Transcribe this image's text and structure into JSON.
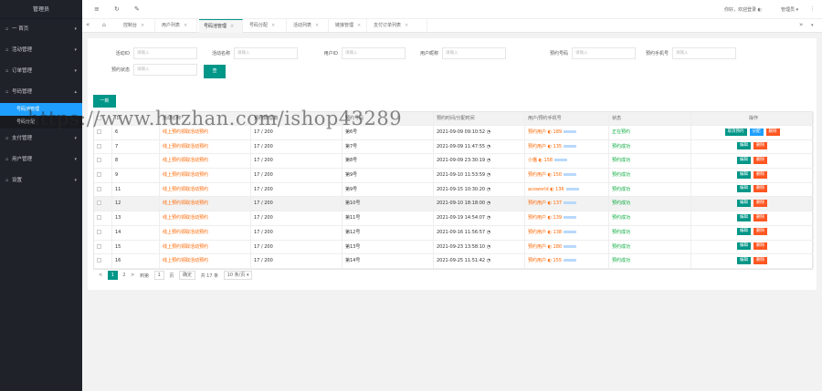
{
  "sidebar": {
    "logo": "管理员",
    "items": [
      {
        "label": "一 首页",
        "icon": "home-icon",
        "chevron": "▾"
      },
      {
        "label": "活动管理",
        "icon": "grid-icon",
        "chevron": "▾"
      },
      {
        "label": "订单管理",
        "icon": "list-icon",
        "chevron": "▾"
      },
      {
        "label": "号码管理",
        "icon": "tag-icon",
        "chevron": "▴"
      }
    ],
    "sub_items": [
      "号码池管理",
      "号码分配"
    ],
    "items_after": [
      {
        "label": "支付管理",
        "icon": "wallet-icon",
        "chevron": "▾"
      },
      {
        "label": "用户管理",
        "icon": "user-icon",
        "chevron": "▾"
      },
      {
        "label": "设置",
        "icon": "gear-icon",
        "chevron": "▾"
      }
    ]
  },
  "header": {
    "user_text": "你好，欢迎登录 ◐",
    "admin": "管理员 ▾",
    "more": "⋮"
  },
  "tabs": [
    {
      "label": "控制台"
    },
    {
      "label": "用户列表"
    },
    {
      "label": "号码池管理"
    },
    {
      "label": "号码分配"
    },
    {
      "label": "活动列表"
    },
    {
      "label": "链接管理"
    },
    {
      "label": "支付订单列表"
    }
  ],
  "filters": [
    {
      "label": "活动ID",
      "placeholder": "请输入"
    },
    {
      "label": "活动名称",
      "placeholder": "请输入"
    },
    {
      "label": "用户ID",
      "placeholder": "请输入"
    },
    {
      "label": "用户昵称",
      "placeholder": "请输入"
    },
    {
      "label": "预约号码",
      "placeholder": "请输入"
    },
    {
      "label": "预约手机号",
      "placeholder": "请输入"
    },
    {
      "label": "预约状态",
      "placeholder": "请输入"
    }
  ],
  "search_label": "查",
  "add_label": "一新",
  "table": {
    "headers": [
      "ID",
      "活动名称",
      "预约数/总数",
      "预约号码",
      "预约时间/分配时间",
      "用户/预约手机号",
      "状态",
      "操作"
    ],
    "rows": [
      {
        "id": "6",
        "name": "线上预约领取活动预约",
        "count": "17 / 200",
        "num": "第6号",
        "time": "2021-09-09 09:10:52",
        "user": "预约用户 ◐ 189",
        "status": "正在预约",
        "ops": [
          "取消预约",
          "分配",
          "删除"
        ],
        "hl": false
      },
      {
        "id": "7",
        "name": "线上预约领取活动预约",
        "count": "17 / 200",
        "num": "第7号",
        "time": "2021-09-09 11:47:55",
        "user": "预约用户 ◐ 135",
        "status": "预约成功",
        "ops": [
          "编辑",
          "删除"
        ],
        "hl": false
      },
      {
        "id": "8",
        "name": "线上预约领取活动预约",
        "count": "17 / 200",
        "num": "第8号",
        "time": "2021-09-09 23:30:19",
        "user": "小猫 ◐ 158",
        "status": "预约成功",
        "ops": [
          "编辑",
          "删除"
        ],
        "hl": false
      },
      {
        "id": "9",
        "name": "线上预约领取活动预约",
        "count": "17 / 200",
        "num": "第9号",
        "time": "2021-09-10 11:53:59",
        "user": "预约用户 ◐ 150",
        "status": "预约成功",
        "ops": [
          "编辑",
          "删除"
        ],
        "hl": false
      },
      {
        "id": "11",
        "name": "线上预约领取活动预约",
        "count": "17 / 200",
        "num": "第9号",
        "time": "2021-09-15 10:30:20",
        "user": "acoworld ◐ 136",
        "status": "预约成功",
        "ops": [
          "编辑",
          "删除"
        ],
        "hl": false
      },
      {
        "id": "12",
        "name": "线上预约领取活动预约",
        "count": "17 / 200",
        "num": "第10号",
        "time": "2021-09-10 18:18:00",
        "user": "预约用户 ◐ 137",
        "status": "预约成功",
        "ops": [
          "编辑",
          "删除"
        ],
        "hl": true
      },
      {
        "id": "13",
        "name": "线上预约领取活动预约",
        "count": "17 / 200",
        "num": "第11号",
        "time": "2021-09-19 14:54:07",
        "user": "预约用户 ◐ 139",
        "status": "预约成功",
        "ops": [
          "编辑",
          "删除"
        ],
        "hl": false
      },
      {
        "id": "14",
        "name": "线上预约领取活动预约",
        "count": "17 / 200",
        "num": "第12号",
        "time": "2021-09-16 11:56:57",
        "user": "预约用户 ◐ 138",
        "status": "预约成功",
        "ops": [
          "编辑",
          "删除"
        ],
        "hl": false
      },
      {
        "id": "15",
        "name": "线上预约领取活动预约",
        "count": "17 / 200",
        "num": "第13号",
        "time": "2021-09-23 13:58:10",
        "user": "预约用户 ◐ 180",
        "status": "预约成功",
        "ops": [
          "编辑",
          "删除"
        ],
        "hl": false
      },
      {
        "id": "16",
        "name": "线上预约领取活动预约",
        "count": "17 / 200",
        "num": "第14号",
        "time": "2021-09-25 11:51:42",
        "user": "预约用户 ◐ 155",
        "status": "预约成功",
        "ops": [
          "编辑",
          "删除"
        ],
        "hl": false
      }
    ]
  },
  "pager": {
    "current": "1",
    "page2": "2",
    "next": ">",
    "goto": "到第",
    "page_input": "1",
    "page_unit": "页",
    "confirm": "确定",
    "total": "共 17 条",
    "per_page": "10 条/页 ▾"
  },
  "watermark": "https://www.huzhan.com/ishop43289"
}
